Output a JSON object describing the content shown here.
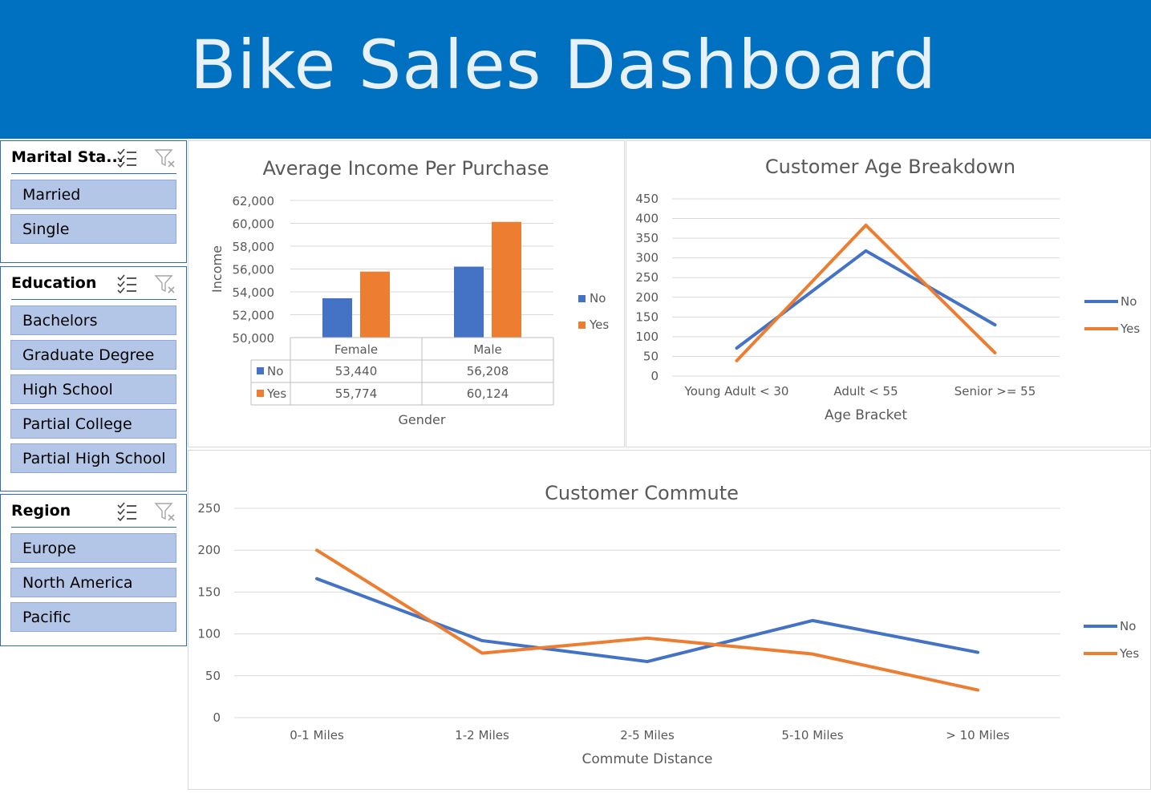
{
  "header": {
    "title": "Bike Sales Dashboard"
  },
  "slicers": {
    "marital": {
      "title": "Marital Sta...",
      "items": [
        "Married",
        "Single"
      ]
    },
    "education": {
      "title": "Education",
      "items": [
        "Bachelors",
        "Graduate Degree",
        "High School",
        "Partial College",
        "Partial High School"
      ]
    },
    "region": {
      "title": "Region",
      "items": [
        "Europe",
        "North America",
        "Pacific"
      ]
    }
  },
  "colors": {
    "header": "#0070c0",
    "no": "#4472c4",
    "yes": "#ed7d31",
    "slicer_item": "#b4c6e7"
  },
  "icons": [
    "multi-select-icon",
    "clear-filter-icon"
  ],
  "chart_data": [
    {
      "type": "bar",
      "title": "Average Income Per Purchase",
      "xlabel": "Gender",
      "ylabel": "Income",
      "categories": [
        "Female",
        "Male"
      ],
      "ylim": [
        50000,
        62000
      ],
      "yticks": [
        "62,000",
        "60,000",
        "58,000",
        "56,000",
        "54,000",
        "52,000",
        "50,000"
      ],
      "series": [
        {
          "name": "No",
          "values": [
            53440
          ],
          "labels": [
            "53,440",
            "56,208"
          ],
          "all": [
            53440,
            56208
          ]
        },
        {
          "name": "Yes",
          "values": [
            55774
          ],
          "labels": [
            "55,774",
            "60,124"
          ],
          "all": [
            55774,
            60124
          ]
        }
      ],
      "legend": "right",
      "data_table": true
    },
    {
      "type": "line",
      "title": "Customer Age Breakdown",
      "xlabel": "Age Bracket",
      "ylabel": "",
      "categories": [
        "Young Adult  < 30",
        "Adult < 55",
        "Senior >= 55"
      ],
      "ylim": [
        0,
        450
      ],
      "yticks": [
        "450",
        "400",
        "350",
        "300",
        "250",
        "200",
        "150",
        "100",
        "50",
        "0"
      ],
      "series": [
        {
          "name": "No",
          "values": [
            71,
            318,
            130
          ]
        },
        {
          "name": "Yes",
          "values": [
            39,
            383,
            59
          ]
        }
      ],
      "legend": "right"
    },
    {
      "type": "line",
      "title": "Customer Commute",
      "xlabel": "Commute Distance",
      "ylabel": "",
      "categories": [
        "0-1 Miles",
        "1-2 Miles",
        "2-5 Miles",
        "5-10 Miles",
        "> 10 Miles"
      ],
      "ylim": [
        0,
        250
      ],
      "yticks": [
        "250",
        "200",
        "150",
        "100",
        "50",
        "0"
      ],
      "series": [
        {
          "name": "No",
          "values": [
            166,
            92,
            67,
            116,
            78
          ]
        },
        {
          "name": "Yes",
          "values": [
            200,
            77,
            95,
            76,
            33
          ]
        }
      ],
      "legend": "right"
    }
  ]
}
